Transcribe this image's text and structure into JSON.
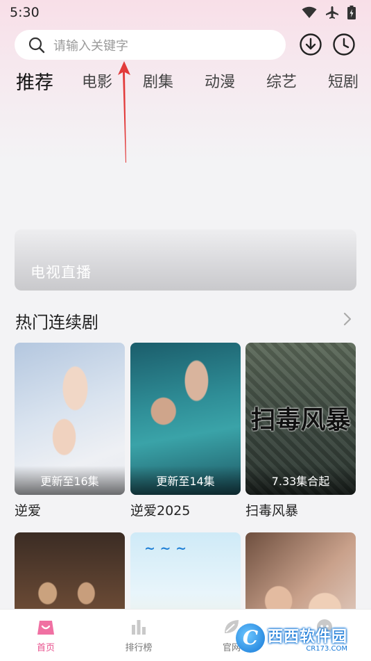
{
  "status_bar": {
    "time": "5:30",
    "icons": [
      "wifi-icon",
      "airplane-icon",
      "battery-icon"
    ]
  },
  "search": {
    "placeholder": "请输入关键字",
    "icon": "search-icon"
  },
  "header_actions": [
    "download-icon",
    "history-icon"
  ],
  "tabs": [
    {
      "label": "推荐",
      "active": true
    },
    {
      "label": "电影"
    },
    {
      "label": "剧集"
    },
    {
      "label": "动漫"
    },
    {
      "label": "综艺"
    },
    {
      "label": "短剧"
    }
  ],
  "banner": {
    "label": "电视直播"
  },
  "section": {
    "title": "热门连续剧",
    "more_icon": "chevron-right-icon"
  },
  "cards": [
    {
      "title": "逆爱",
      "badge": "更新至16集"
    },
    {
      "title": "逆爱2025",
      "badge": "更新至14集"
    },
    {
      "title": "扫毒风暴",
      "badge": "7.33集合起",
      "poster_text": "扫毒风暴"
    },
    {
      "title": "",
      "badge": ""
    },
    {
      "title": "",
      "badge": ""
    },
    {
      "title": "",
      "badge": ""
    }
  ],
  "bottom_nav": [
    {
      "label": "首页",
      "icon": "home-bag-icon",
      "active": true
    },
    {
      "label": "排行榜",
      "icon": "bar-chart-icon"
    },
    {
      "label": "官网",
      "icon": "leaf-icon"
    },
    {
      "label": "",
      "icon": "profile-icon"
    }
  ],
  "watermark": {
    "main": "西西软件园",
    "sub": "CR173.COM",
    "circle": "C"
  },
  "colors": {
    "accent": "#e8508d",
    "annotation": "#e23a3a"
  }
}
